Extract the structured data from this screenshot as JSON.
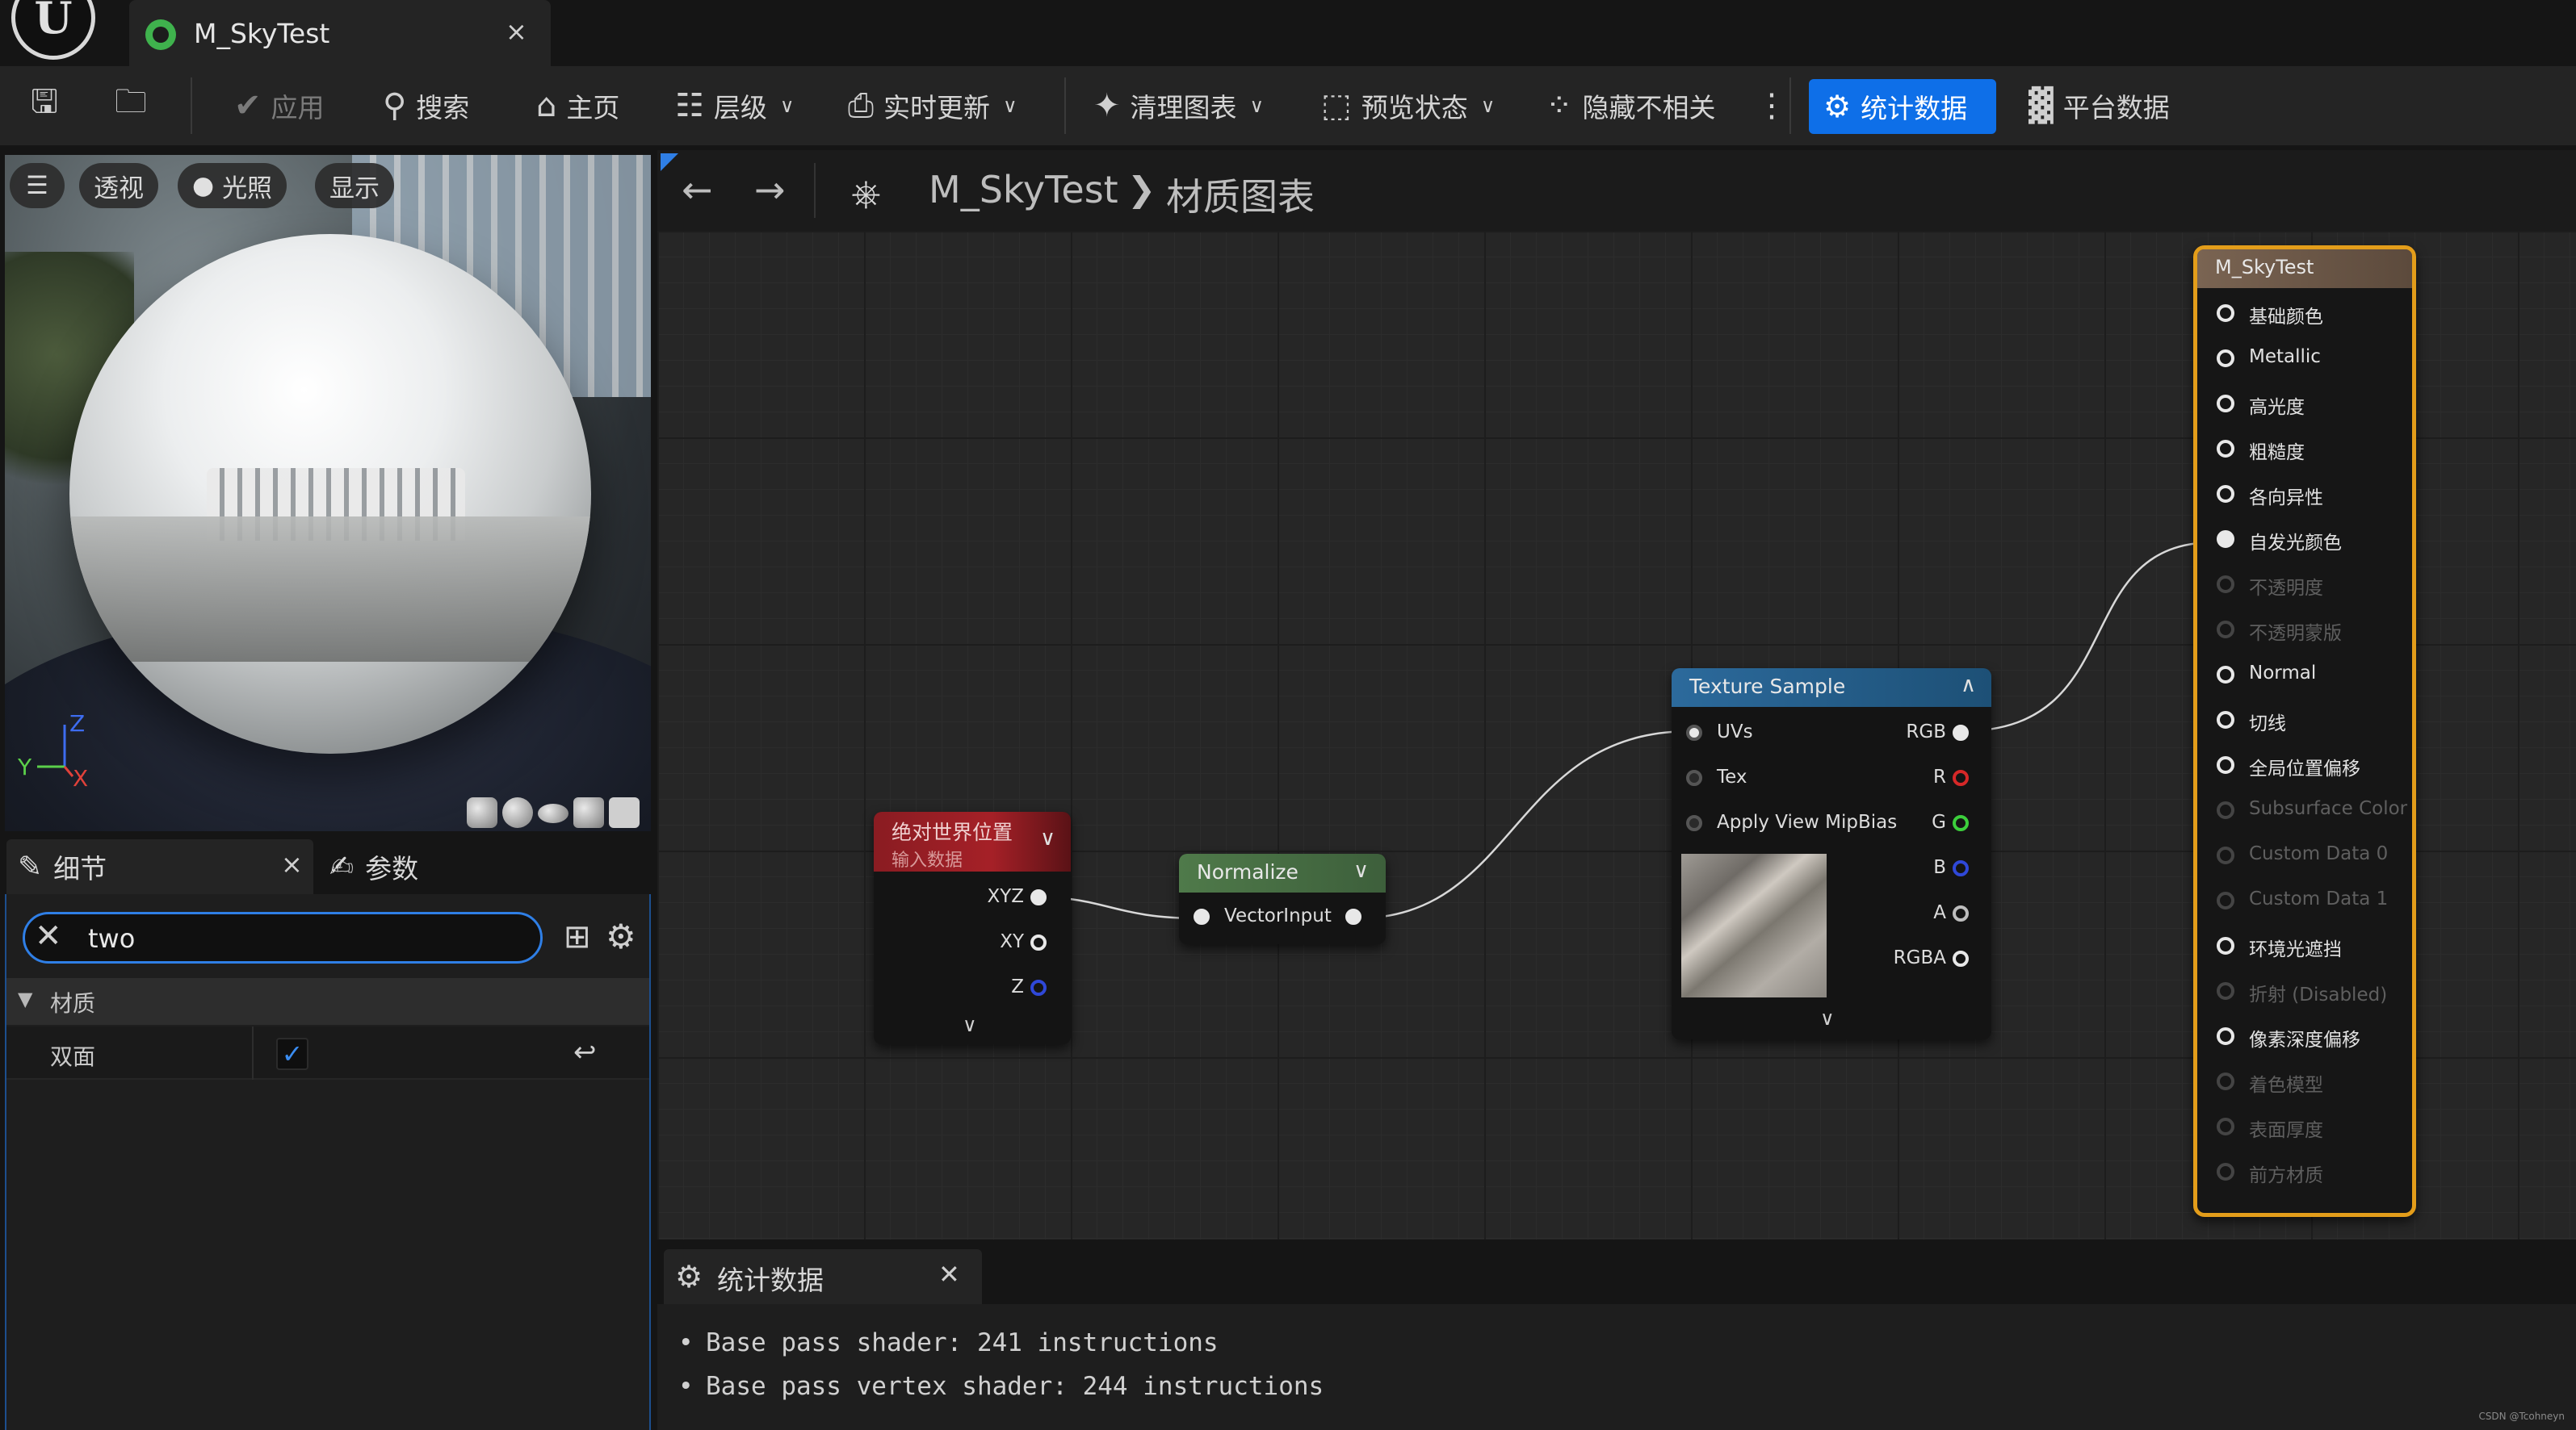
{
  "title_bar": {
    "logo_icon": "unreal-engine-logo",
    "tab_label": "M_SkyTest",
    "tab_icon": "material-asset-icon",
    "close_glyph": "×"
  },
  "toolbar": {
    "save_icon": "save-icon",
    "browse_icon": "browse-asset-icon",
    "apply": "应用",
    "search": "搜索",
    "home": "主页",
    "hierarchy": "层级",
    "live_update": "实时更新",
    "clean_graph": "清理图表",
    "preview_state": "预览状态",
    "hide_unrelated": "隐藏不相关",
    "more_glyph": "⋮",
    "stats": "统计数据",
    "platform_stats": "平台数据",
    "accent_color": "#0e6fe8"
  },
  "viewport": {
    "perspective": "透视",
    "lighting": "光照",
    "show": "显示",
    "axis_z": "Z",
    "axis_y": "Y",
    "axis_x": "X",
    "preview_shapes": [
      "cylinder",
      "sphere",
      "plane",
      "cube",
      "custom-mesh"
    ]
  },
  "details": {
    "tab_details": "细节",
    "tab_params": "参数",
    "close_glyph": "×",
    "search_value": "two",
    "category": "材质",
    "property_label": "双面",
    "property_checked": true
  },
  "graph_header": {
    "asset_name": "M_SkyTest",
    "graph_name": "材质图表"
  },
  "nodes": {
    "abs_world": {
      "title": "绝对世界位置",
      "subtitle": "输入数据",
      "outputs": [
        "XYZ",
        "XY",
        "Z"
      ]
    },
    "normalize": {
      "title": "Normalize",
      "input": "VectorInput"
    },
    "texture": {
      "title": "Texture Sample",
      "inputs": [
        "UVs",
        "Tex",
        "Apply View MipBias"
      ],
      "outputs": [
        "RGB",
        "R",
        "G",
        "B",
        "A",
        "RGBA"
      ]
    },
    "result": {
      "title": "M_SkyTest",
      "pins": [
        {
          "label": "基础颜色",
          "active": true,
          "connected": false
        },
        {
          "label": "Metallic",
          "active": true,
          "connected": false
        },
        {
          "label": "高光度",
          "active": true,
          "connected": false
        },
        {
          "label": "粗糙度",
          "active": true,
          "connected": false
        },
        {
          "label": "各向异性",
          "active": true,
          "connected": false
        },
        {
          "label": "自发光颜色",
          "active": true,
          "connected": true
        },
        {
          "label": "不透明度",
          "active": false,
          "connected": false
        },
        {
          "label": "不透明蒙版",
          "active": false,
          "connected": false
        },
        {
          "label": "Normal",
          "active": true,
          "connected": false
        },
        {
          "label": "切线",
          "active": true,
          "connected": false
        },
        {
          "label": "全局位置偏移",
          "active": true,
          "connected": false
        },
        {
          "label": "Subsurface Color",
          "active": false,
          "connected": false
        },
        {
          "label": "Custom Data 0",
          "active": false,
          "connected": false
        },
        {
          "label": "Custom Data 1",
          "active": false,
          "connected": false
        },
        {
          "label": "环境光遮挡",
          "active": true,
          "connected": false
        },
        {
          "label": "折射 (Disabled)",
          "active": false,
          "connected": false
        },
        {
          "label": "像素深度偏移",
          "active": true,
          "connected": false
        },
        {
          "label": "着色模型",
          "active": false,
          "connected": false
        },
        {
          "label": "表面厚度",
          "active": false,
          "connected": false
        },
        {
          "label": "前方材质",
          "active": false,
          "connected": false
        }
      ],
      "border_color": "#e39d1a"
    }
  },
  "stats_panel": {
    "tab_label": "统计数据",
    "lines": [
      "Base pass shader: 241 instructions",
      "Base pass vertex shader: 244 instructions"
    ]
  },
  "watermark": "CSDN @Tcohneyn"
}
